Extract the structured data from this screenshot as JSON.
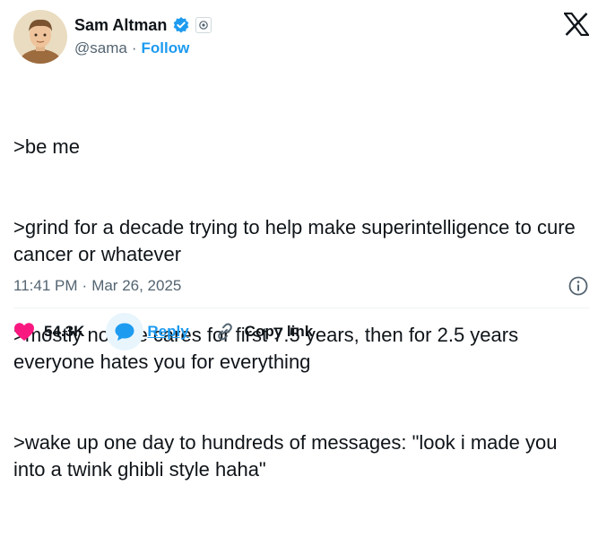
{
  "author": {
    "name": "Sam Altman",
    "handle": "@sama",
    "follow_label": "Follow",
    "verified_color": "#1d9bf0"
  },
  "tweet": {
    "lines": [
      ">be me",
      ">grind for a decade trying to help make superintelligence to cure cancer or whatever",
      ">mostly no one cares for first 7.5 years, then for 2.5 years everyone hates you for everything",
      ">wake up one day to hundreds of messages: \"look i made you into a twink ghibli style haha\""
    ],
    "time": "11:41 PM",
    "date": "Mar 26, 2025"
  },
  "actions": {
    "like_count": "54.3K",
    "reply_label": "Reply",
    "copy_label": "Copy link"
  },
  "colors": {
    "like": "#f91880",
    "accent": "#1d9bf0",
    "text": "#0f1419",
    "muted": "#536471"
  },
  "icons": [
    "verified-badge-icon",
    "affiliate-badge-icon",
    "x-logo-icon",
    "info-icon",
    "heart-icon",
    "reply-icon",
    "link-icon"
  ]
}
